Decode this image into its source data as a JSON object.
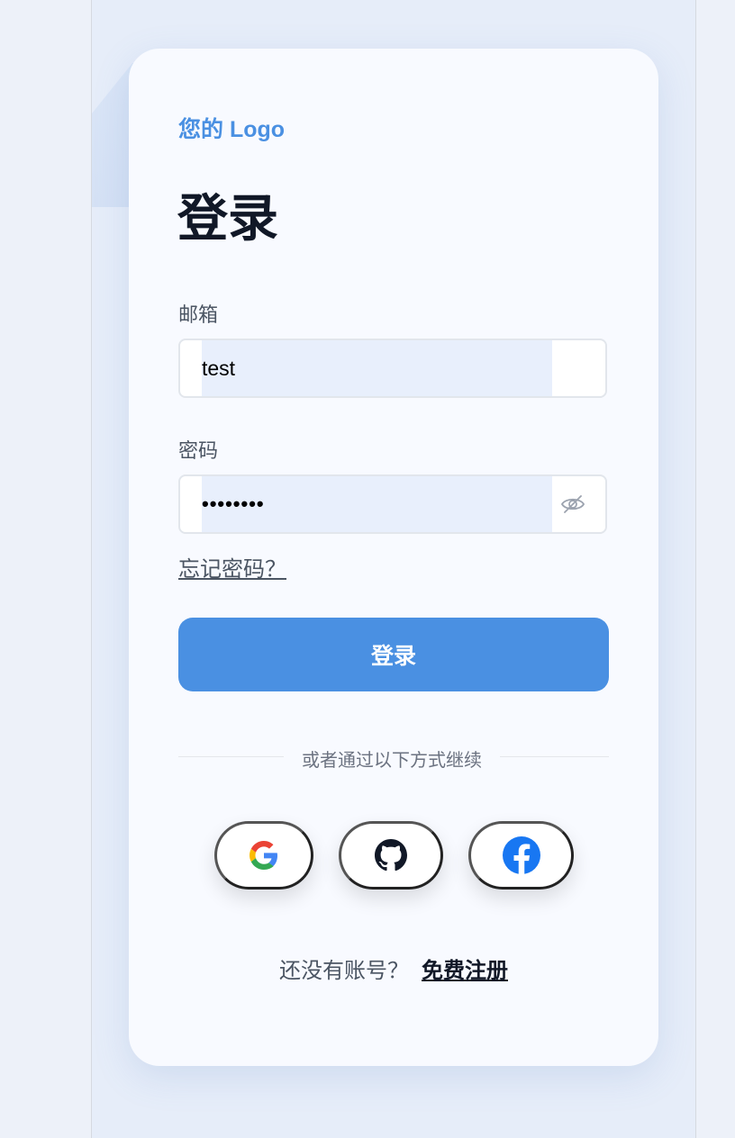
{
  "brand": {
    "logo_text": "您的 Logo",
    "accent_color": "#4a90e2"
  },
  "form": {
    "title": "登录",
    "email": {
      "label": "邮箱",
      "value": "test"
    },
    "password": {
      "label": "密码",
      "masked_value": "••••••••",
      "toggle_icon": "eye-off-icon"
    },
    "forgot_link": "忘记密码？",
    "submit_label": "登录"
  },
  "social": {
    "divider_text": "或者通过以下方式继续",
    "providers": [
      {
        "name": "google",
        "icon": "google-icon"
      },
      {
        "name": "github",
        "icon": "github-icon"
      },
      {
        "name": "facebook",
        "icon": "facebook-icon"
      }
    ]
  },
  "footer": {
    "prompt": "还没有账号？",
    "signup_link": "免费注册"
  }
}
